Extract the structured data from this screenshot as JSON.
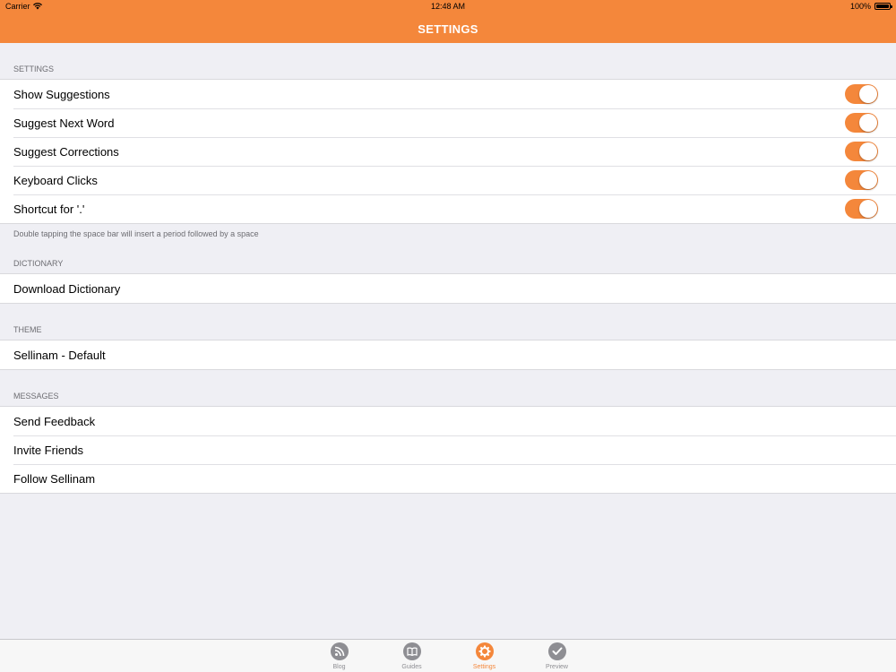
{
  "status_bar": {
    "carrier": "Carrier",
    "time": "12:48 AM",
    "battery": "100%"
  },
  "nav": {
    "title": "SETTINGS"
  },
  "sections": {
    "settings": {
      "header": "SETTINGS",
      "rows": [
        {
          "label": "Show Suggestions",
          "on": true
        },
        {
          "label": "Suggest Next Word",
          "on": true
        },
        {
          "label": "Suggest Corrections",
          "on": true
        },
        {
          "label": "Keyboard Clicks",
          "on": true
        },
        {
          "label": "Shortcut for '.'",
          "on": true
        }
      ],
      "footer": "Double tapping the space bar will insert a period followed by a space"
    },
    "dictionary": {
      "header": "DICTIONARY",
      "rows": [
        {
          "label": "Download Dictionary"
        }
      ]
    },
    "theme": {
      "header": "THEME",
      "rows": [
        {
          "label": "Sellinam - Default"
        }
      ]
    },
    "messages": {
      "header": "MESSAGES",
      "rows": [
        {
          "label": "Send Feedback"
        },
        {
          "label": "Invite Friends"
        },
        {
          "label": "Follow Sellinam"
        }
      ]
    }
  },
  "tabs": [
    {
      "label": "Blog",
      "icon": "rss-icon",
      "active": false
    },
    {
      "label": "Guides",
      "icon": "book-icon",
      "active": false
    },
    {
      "label": "Settings",
      "icon": "gear-icon",
      "active": true
    },
    {
      "label": "Preview",
      "icon": "checkmark-icon",
      "active": false
    }
  ],
  "colors": {
    "accent": "#f4873b",
    "background": "#efeff4",
    "inactive_tab": "#8e8e93"
  }
}
